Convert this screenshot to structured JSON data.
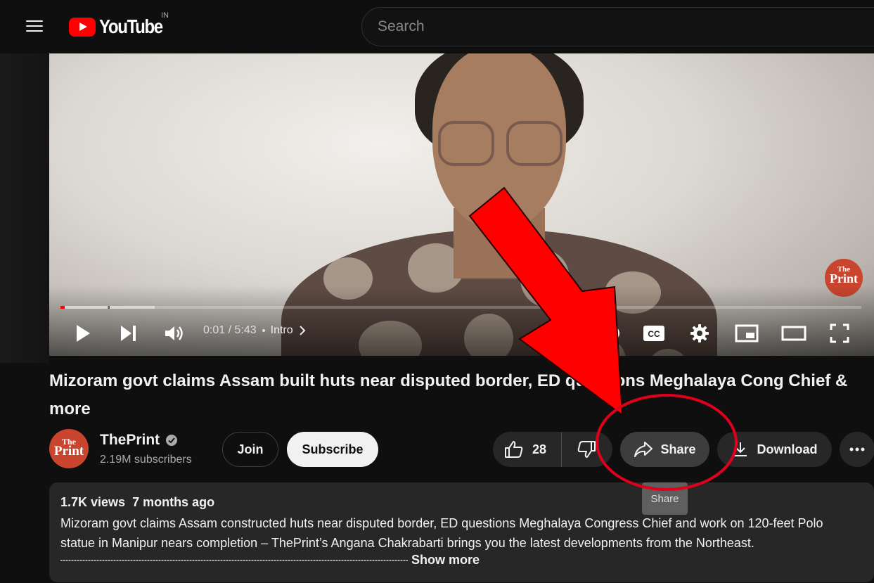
{
  "header": {
    "logo_text": "YouTube",
    "country_code": "IN",
    "search_placeholder": "Search"
  },
  "player": {
    "current_time": "0:01",
    "separator": "/",
    "duration": "5:43",
    "chapter": "Intro",
    "watermark_line1": "The",
    "watermark_line2": "Print",
    "progress_fraction": 0.003
  },
  "video": {
    "title": "Mizoram govt claims Assam built huts near disputed border, ED questions Meghalaya Cong Chief & more"
  },
  "channel": {
    "name": "ThePrint",
    "verified": true,
    "subscribers": "2.19M subscribers",
    "avatar_line1": "The",
    "avatar_line2": "Print"
  },
  "actions": {
    "join_label": "Join",
    "subscribe_label": "Subscribe",
    "like_count": "28",
    "share_label": "Share",
    "download_label": "Download",
    "share_tooltip": "Share"
  },
  "description": {
    "views": "1.7K views",
    "age": "7 months ago",
    "text": "Mizoram govt claims Assam constructed huts near disputed border, ED questions Meghalaya Congress Chief and work on 120-feet Polo statue in Manipur nears completion – ThePrint’s Angana Chakrabarti brings you the latest developments from the Northeast.",
    "show_more_label": "Show more"
  },
  "annotation": {
    "arrow_color": "#ff0000",
    "circle_color": "#e0001b"
  }
}
